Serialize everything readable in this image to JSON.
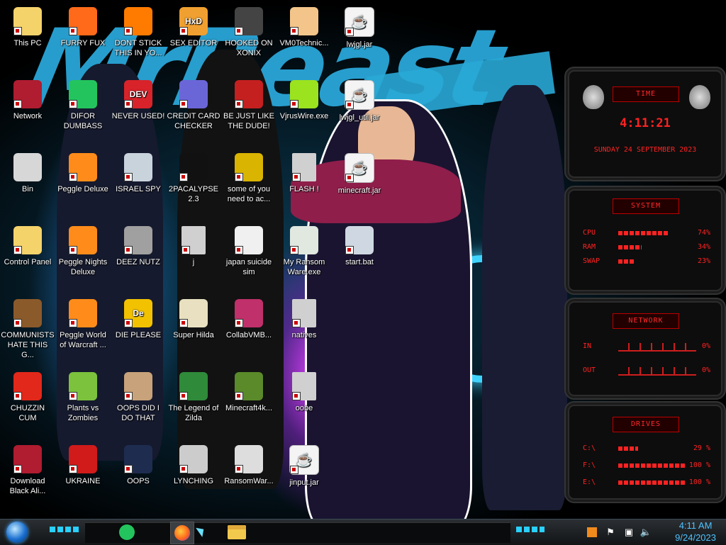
{
  "desktop": {
    "col1": [
      {
        "label": "This PC",
        "icon": "star-butterfly-icon",
        "color": "#f5d36b"
      },
      {
        "label": "Network",
        "icon": "alien-orb-icon",
        "color": "#b01c30"
      },
      {
        "label": "Bin",
        "icon": "recycle-bin-icon",
        "color": "#d7d7d7"
      },
      {
        "label": "Control Panel",
        "icon": "star-butterfly-icon",
        "color": "#f5d36b"
      },
      {
        "label": "COMMUNISTS HATE THIS G...",
        "icon": "money-bag-icon",
        "color": "#8b5a2b"
      },
      {
        "label": "CHUZZIN CUM",
        "icon": "chuzzle-icon",
        "color": "#e2281a"
      },
      {
        "label": "Download Black Ali...",
        "icon": "alien-orb-icon",
        "color": "#b01c30"
      }
    ],
    "col2": [
      {
        "label": "FURRY FUX",
        "icon": "firefox-icon",
        "color": "#ff6a1a"
      },
      {
        "label": "DIFOR DUMBASS",
        "icon": "green-chat-icon",
        "color": "#23c45e"
      },
      {
        "label": "Peggle Deluxe",
        "icon": "peggle-icon",
        "color": "#ff8c1a"
      },
      {
        "label": "Peggle Nights Deluxe",
        "icon": "peggle-icon",
        "color": "#ff8c1a"
      },
      {
        "label": "Peggle World of Warcraft ...",
        "icon": "peggle-icon",
        "color": "#ff8c1a"
      },
      {
        "label": "Plants vs Zombies",
        "icon": "flower-icon",
        "color": "#7cc23d"
      },
      {
        "label": "UKRAINE",
        "icon": "radiation-icon",
        "color": "#d11a1a"
      }
    ],
    "col3": [
      {
        "label": "DONT STICK THIS IN YO...",
        "icon": "traffic-cone-icon",
        "color": "#ff7b00"
      },
      {
        "label": "NEVER USED!",
        "icon": "dev-cpp-icon",
        "color": "#d8232a",
        "text": "DEV"
      },
      {
        "label": "ISRAEL SPY",
        "icon": "network-card-icon",
        "color": "#c9d3dc"
      },
      {
        "label": "DEEZ NUTZ",
        "icon": "stacked-windows-icon",
        "color": "#a0a0a0"
      },
      {
        "label": "DIE PLEASE",
        "icon": "die-logo-icon",
        "color": "#f2c200",
        "text": "De"
      },
      {
        "label": "OOPS DID I DO THAT",
        "icon": "portrait-icon",
        "color": "#c8a27a"
      },
      {
        "label": "OOPS",
        "icon": "book-icon",
        "color": "#1e2d4f"
      }
    ],
    "col4": [
      {
        "label": "SEX EDITOR",
        "icon": "hex-editor-icon",
        "color": "#f0a030",
        "text": "HxD"
      },
      {
        "label": "CREDIT CARD CHECKER",
        "icon": "credit-card-icon",
        "color": "#6b66d8"
      },
      {
        "label": "2PACALYPSE 2.3",
        "icon": "terminal-icon",
        "color": "#111111"
      },
      {
        "label": "j",
        "icon": "folder-icon",
        "color": "#d0d0d0"
      },
      {
        "label": "Super Hilda",
        "icon": "pixel-sprite-icon",
        "color": "#e8e0c0"
      },
      {
        "label": "The Legend of Zilda",
        "icon": "pixel-hero-icon",
        "color": "#2f8a3a"
      },
      {
        "label": "LYNCHING",
        "icon": "noose-icon",
        "color": "#cccccc"
      }
    ],
    "col5": [
      {
        "label": "HOOKED ON XONIX",
        "icon": "xonix-icon",
        "color": "#444444"
      },
      {
        "label": "BE JUST LIKE THE DUDE!",
        "icon": "santa-icon",
        "color": "#c42020"
      },
      {
        "label": "some of you need to ac...",
        "icon": "dog-icon",
        "color": "#d9b400"
      },
      {
        "label": "japan suicide sim",
        "icon": "document-icon",
        "color": "#f0f0f0"
      },
      {
        "label": "CollabVMB...",
        "icon": "collabvm-icon",
        "color": "#c0306a"
      },
      {
        "label": "Minecraft4k...",
        "icon": "grass-block-icon",
        "color": "#5a8a2a"
      },
      {
        "label": "RansomWar...",
        "icon": "skull-icon",
        "color": "#dddddd"
      }
    ],
    "col6": [
      {
        "label": "VM0Technic...",
        "icon": "doctor-icon",
        "color": "#f3c58a"
      },
      {
        "label": "VjrusWire.exe",
        "icon": "lime-icon",
        "color": "#9be31f"
      },
      {
        "label": "FLASH !",
        "icon": "folder-icon",
        "color": "#d0d0d0"
      },
      {
        "label": "My Ransom Ware.exe",
        "icon": "app-window-icon",
        "color": "#e0e8e0"
      },
      {
        "label": "natives",
        "icon": "folder-icon",
        "color": "#d0d0d0"
      },
      {
        "label": "oobe",
        "icon": "folder-icon",
        "color": "#d0d0d0"
      },
      {
        "label": "jinput.jar",
        "icon": "java-icon",
        "color": "#f4f4f4"
      }
    ],
    "col7": [
      {
        "label": "lwjgl.jar",
        "icon": "java-icon",
        "color": "#f4f4f4"
      },
      {
        "label": "lwjgl_util.jar",
        "icon": "java-icon",
        "color": "#f4f4f4"
      },
      {
        "label": "minecraft.jar",
        "icon": "java-icon",
        "color": "#f4f4f4"
      },
      {
        "label": "start.bat",
        "icon": "gear-icon",
        "color": "#cfd8e2"
      }
    ]
  },
  "wallpaper": {
    "brush_text": "MrBeast"
  },
  "widget": {
    "time": {
      "title": "TIME",
      "clock": "4:11:21",
      "date": "SUNDAY 24 SEPTEMBER 2023"
    },
    "system": {
      "title": "SYSTEM",
      "rows": [
        {
          "k": "CPU",
          "v": "74%",
          "p": 0.74
        },
        {
          "k": "RAM",
          "v": "34%",
          "p": 0.34
        },
        {
          "k": "SWAP",
          "v": "23%",
          "p": 0.23
        }
      ]
    },
    "network": {
      "title": "NETWORK",
      "rows": [
        {
          "k": "IN",
          "v": "0%"
        },
        {
          "k": "OUT",
          "v": "0%"
        }
      ]
    },
    "drives": {
      "title": "DRIVES",
      "rows": [
        {
          "k": "C:\\",
          "v": "29 %",
          "p": 0.29
        },
        {
          "k": "F:\\",
          "v": "100 %",
          "p": 1.0
        },
        {
          "k": "E:\\",
          "v": "100 %",
          "p": 1.0
        }
      ]
    },
    "accent": "#ff2222"
  },
  "taskbar": {
    "clock_time": "4:11 AM",
    "clock_date": "9/24/2023",
    "accent": "#4fc3ff"
  }
}
